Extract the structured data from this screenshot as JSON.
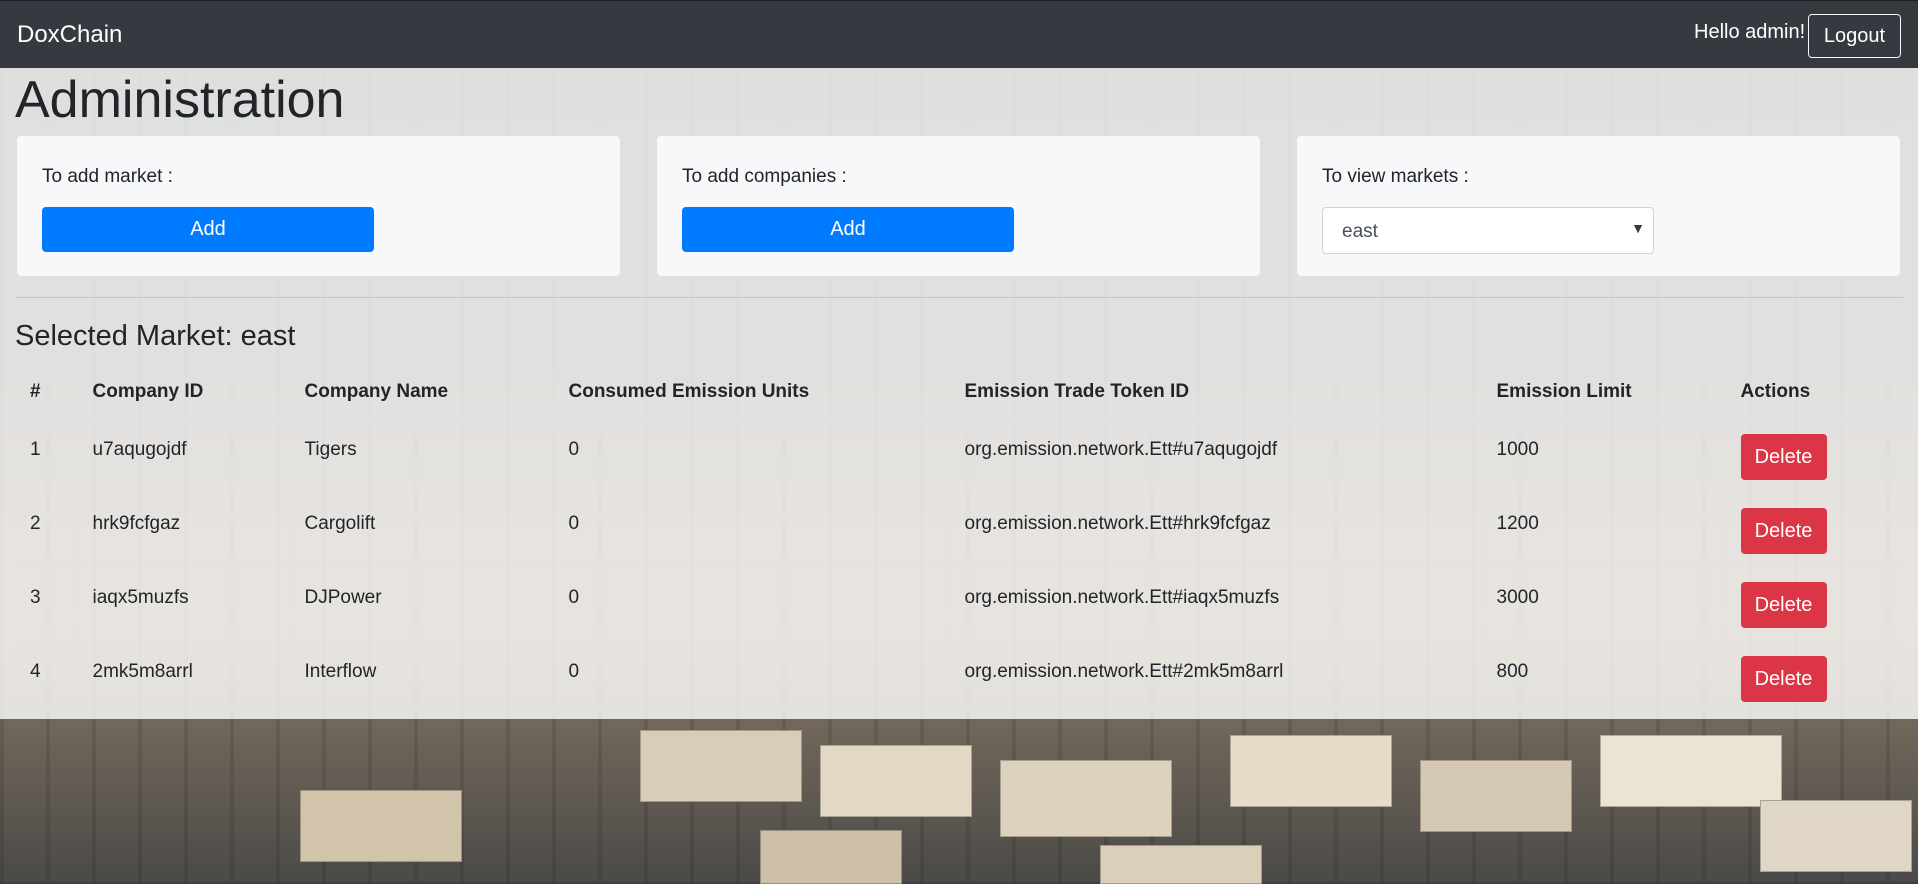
{
  "navbar": {
    "brand": "DoxChain",
    "greeting": "Hello admin!",
    "logout_label": "Logout"
  },
  "page": {
    "title": "Administration",
    "selected_market_heading": "Selected Market: east"
  },
  "cards": {
    "add_market": {
      "label": "To add market :",
      "button": "Add"
    },
    "add_companies": {
      "label": "To add companies :",
      "button": "Add"
    },
    "view_markets": {
      "label": "To view markets :",
      "selected": "east"
    }
  },
  "table": {
    "headers": [
      "#",
      "Company ID",
      "Company Name",
      "Consumed Emission Units",
      "Emission Trade Token ID",
      "Emission Limit",
      "Actions"
    ],
    "rows": [
      {
        "num": "1",
        "company_id": "u7aqugojdf",
        "company_name": "Tigers",
        "consumed": "0",
        "token_id": "org.emission.network.Ett#u7aqugojdf",
        "limit": "1000",
        "action": "Delete"
      },
      {
        "num": "2",
        "company_id": "hrk9fcfgaz",
        "company_name": "Cargolift",
        "consumed": "0",
        "token_id": "org.emission.network.Ett#hrk9fcfgaz",
        "limit": "1200",
        "action": "Delete"
      },
      {
        "num": "3",
        "company_id": "iaqx5muzfs",
        "company_name": "DJPower",
        "consumed": "0",
        "token_id": "org.emission.network.Ett#iaqx5muzfs",
        "limit": "3000",
        "action": "Delete"
      },
      {
        "num": "4",
        "company_id": "2mk5m8arrl",
        "company_name": "Interflow",
        "consumed": "0",
        "token_id": "org.emission.network.Ett#2mk5m8arrl",
        "limit": "800",
        "action": "Delete"
      }
    ]
  }
}
